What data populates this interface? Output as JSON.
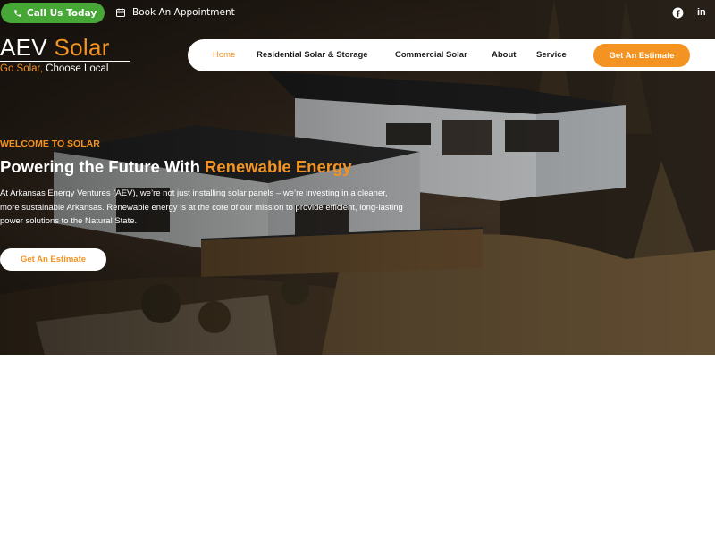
{
  "topbar": {
    "call_label": "Call Us Today",
    "appointment_label": "Book An Appointment",
    "social": {
      "facebook_icon": "facebook-icon",
      "linkedin_label": "in"
    }
  },
  "logo": {
    "title_main": "AEV",
    "title_accent": "Solar",
    "tagline_accent": "Go Solar,",
    "tagline_main": "Choose Local"
  },
  "nav": {
    "items": [
      {
        "label": "Home",
        "active": true
      },
      {
        "label": "Residential Solar & Storage",
        "active": false
      },
      {
        "label": "Commercial Solar",
        "active": false
      },
      {
        "label": "About",
        "active": false
      },
      {
        "label": "Service",
        "active": false
      }
    ],
    "cta_label": "Get An Estimate"
  },
  "hero": {
    "eyebrow": "WELCOME TO SOLAR",
    "headline_main": "Powering the Future With",
    "headline_accent": "Renewable Energy",
    "description": "At Arkansas Energy Ventures (AEV), we’re not just installing solar panels – we’re investing in a cleaner, more sustainable Arkansas. Renewable energy is at the core of our mission to provide efficient, long-lasting power solutions to the Natural State.",
    "cta_label": "Get An Estimate"
  },
  "colors": {
    "accent": "#f39322",
    "call_green": "#46a636",
    "white": "#ffffff"
  }
}
